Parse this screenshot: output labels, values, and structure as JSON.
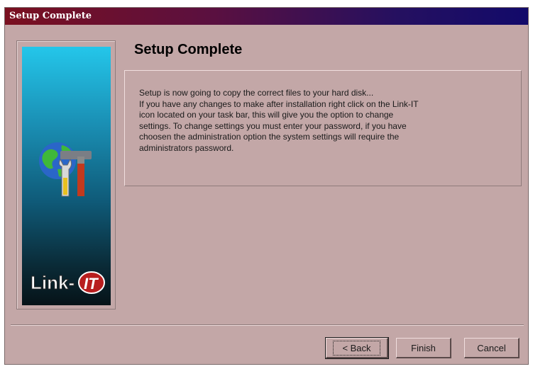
{
  "window": {
    "title": "Setup Complete"
  },
  "heading": "Setup Complete",
  "message": "Setup is now going to copy the correct files to your hard disk...\nIf you have any changes to make after installation right click on the Link-IT\nicon located on your task bar, this will give you the option to change\nsettings.  To change settings you must enter your password, if you have\nchoosen the administration option the system settings will require the\nadministrators password.",
  "logo": {
    "text": "Link-IT"
  },
  "icons": {
    "setup": "globe-tools-icon"
  },
  "buttons": {
    "back": "< Back",
    "finish": "Finish",
    "cancel": "Cancel"
  },
  "colors": {
    "dialog_bg": "#c3a7a7",
    "title_start": "#7a1020",
    "title_end": "#120a6a"
  }
}
